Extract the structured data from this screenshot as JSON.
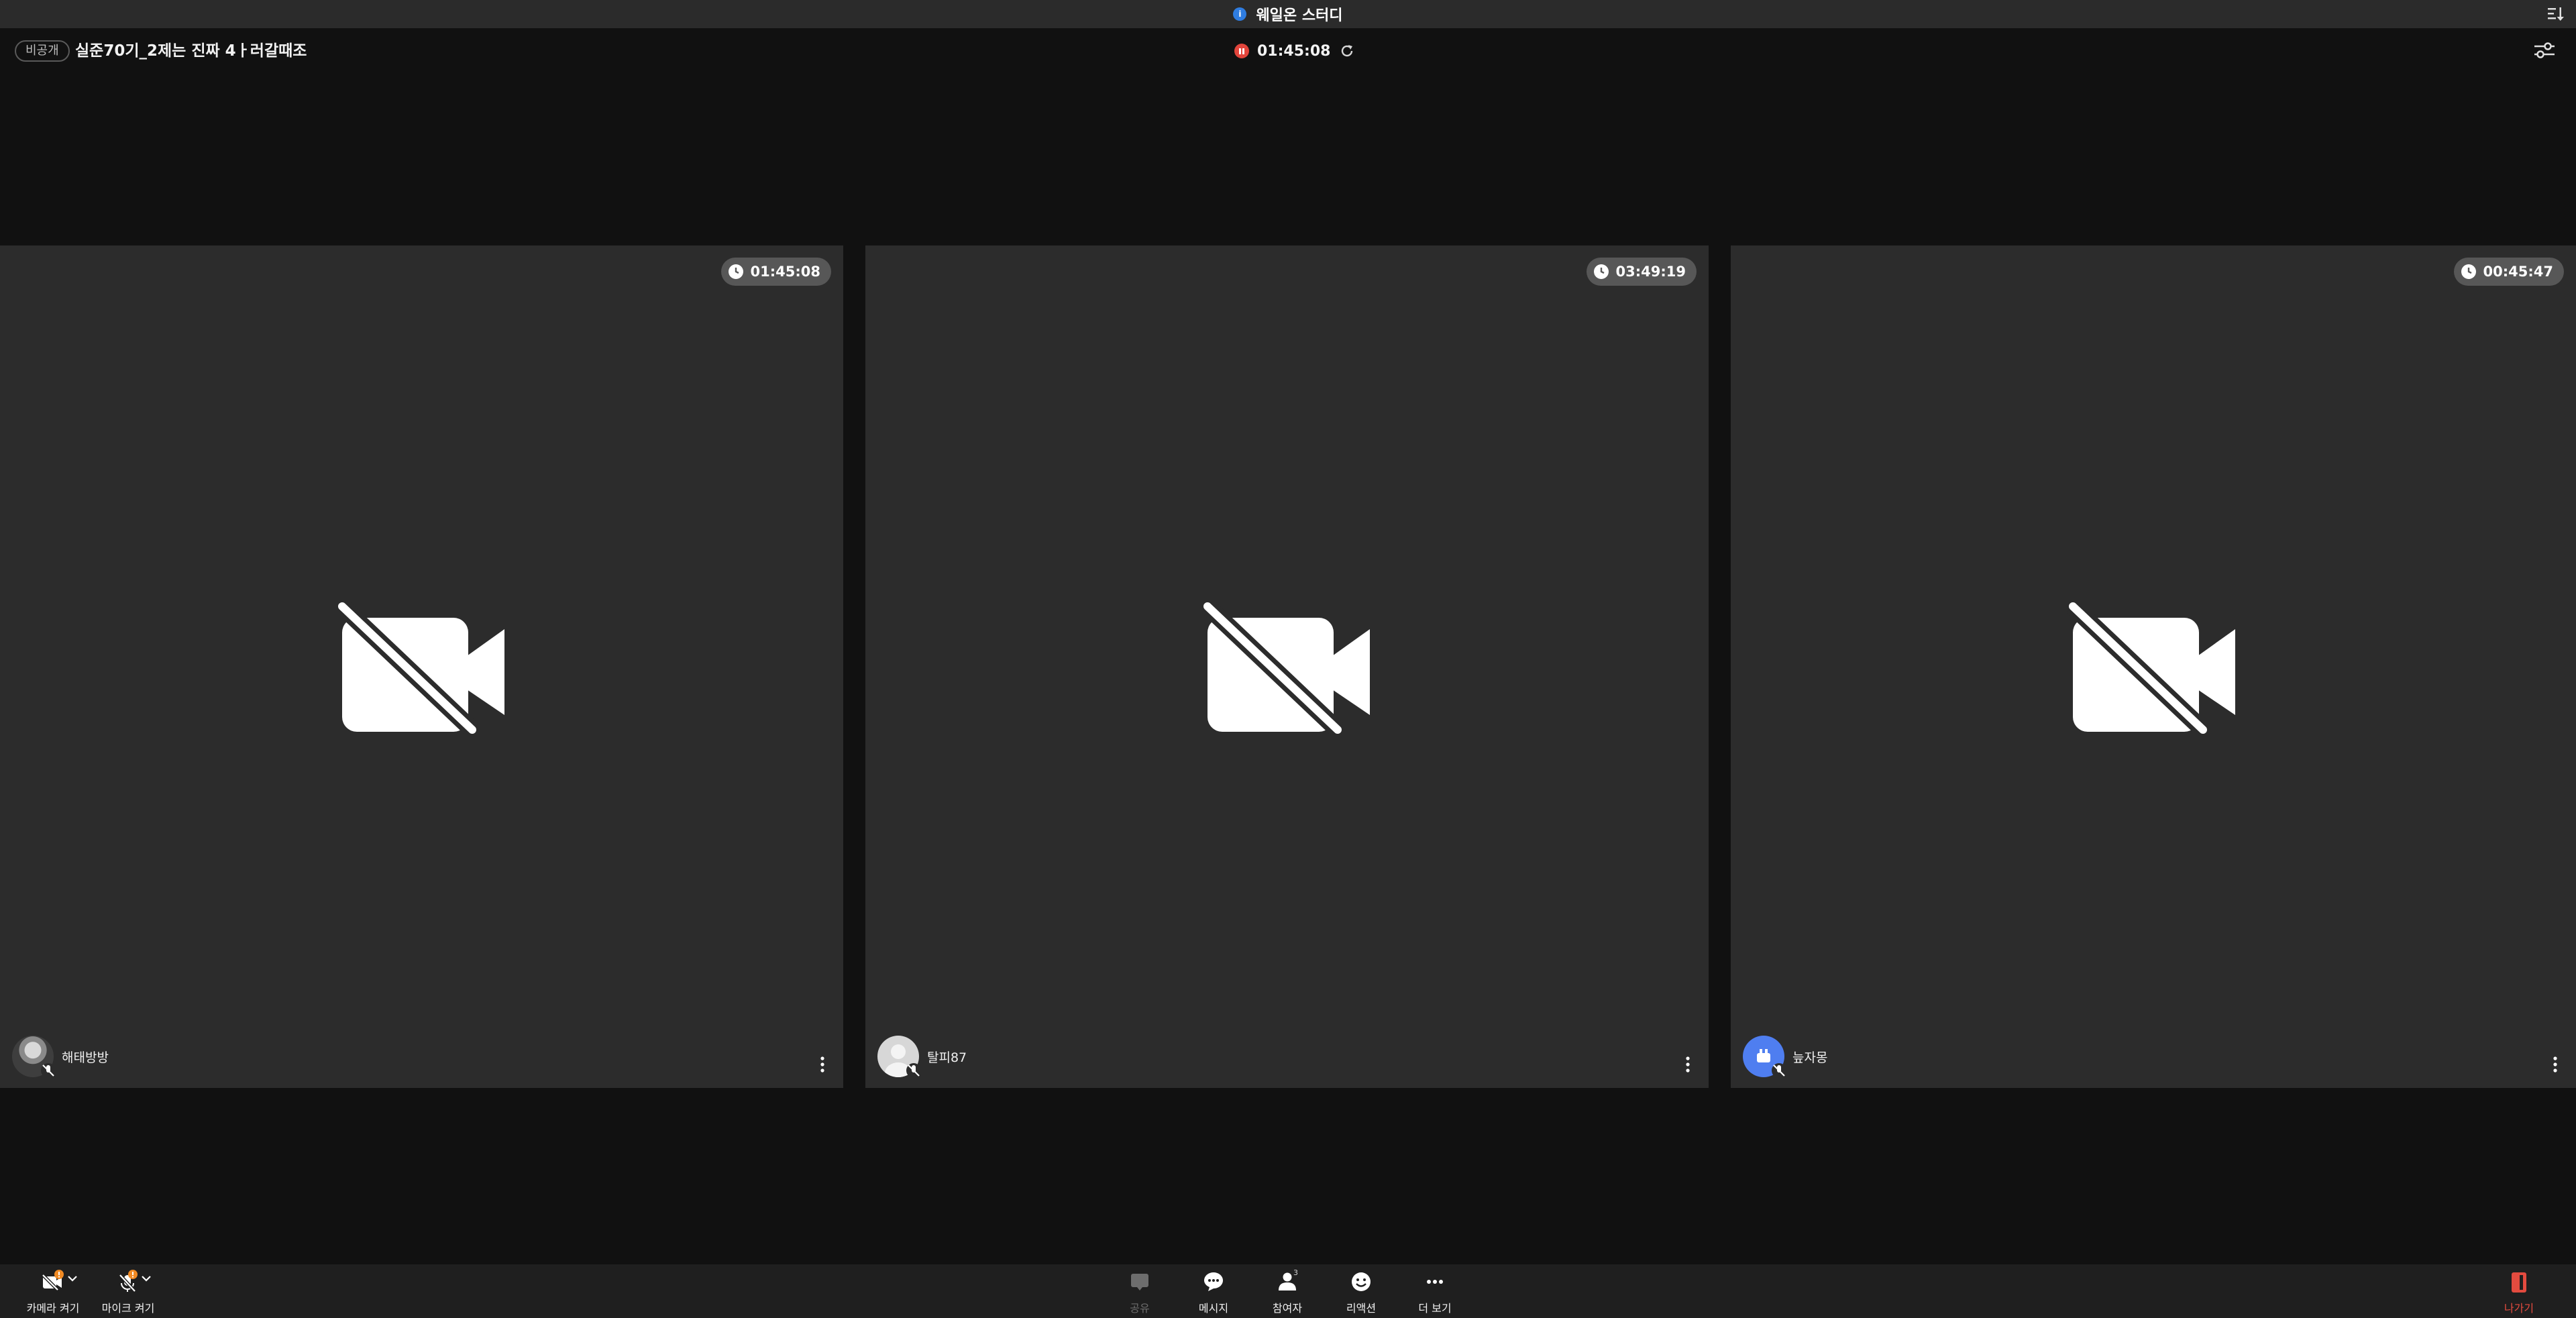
{
  "window": {
    "app_title": "웨일온 스터디",
    "app_icon": "whale-on-logo-icon",
    "sort_icon": "sort-icon"
  },
  "header": {
    "privacy_badge": "비공개",
    "room_title": "실준70기_2제는 진짜 4ㅏ러갈때조",
    "session_timer": "01:45:08",
    "recording_icon": "recording-pause-icon",
    "refresh_icon": "refresh-icon",
    "settings_icon": "settings-sliders-icon"
  },
  "participants": [
    {
      "name": "해태방방",
      "timer": "01:45:08",
      "camera": "off",
      "mic": "muted",
      "avatar": "photo"
    },
    {
      "name": "탈피87",
      "timer": "03:49:19",
      "camera": "off",
      "mic": "muted",
      "avatar": "default-person"
    },
    {
      "name": "늪자몽",
      "timer": "00:45:47",
      "camera": "off",
      "mic": "muted",
      "avatar": "blue-icon"
    }
  ],
  "toolbar": {
    "camera_label": "카메라 켜기",
    "mic_label": "마이크 켜기",
    "share_label": "공유",
    "message_label": "메시지",
    "participants_label": "참여자",
    "participants_count": "3",
    "reaction_label": "리액션",
    "more_label": "더 보기",
    "leave_label": "나가기"
  },
  "colors": {
    "background": "#111111",
    "tile": "#2c2c2c",
    "titlebar": "#2b2b2b",
    "toolbar": "#1f1f1f",
    "record_red": "#e2453c",
    "leave_red": "#e34b3f",
    "accent_blue": "#2f7de1",
    "warning_orange": "#f08a24"
  }
}
